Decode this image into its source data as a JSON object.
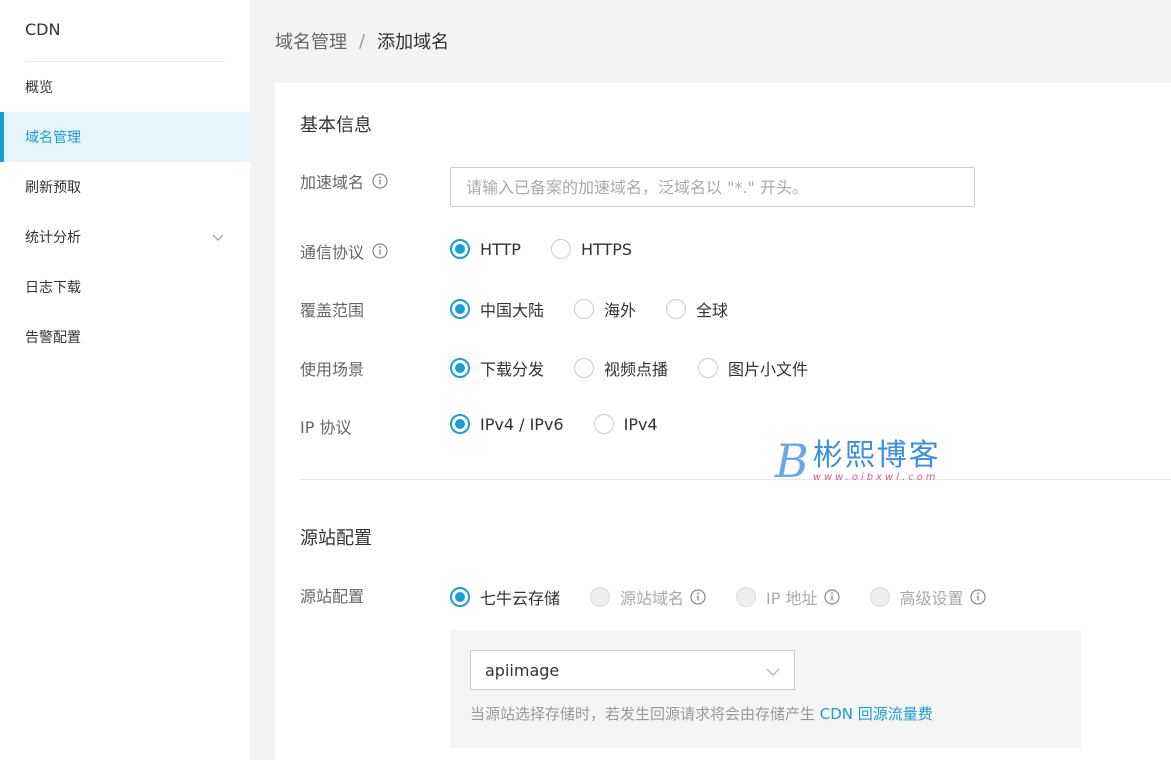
{
  "sidebar": {
    "brand": "CDN",
    "items": [
      {
        "label": "概览"
      },
      {
        "label": "域名管理"
      },
      {
        "label": "刷新预取"
      },
      {
        "label": "统计分析"
      },
      {
        "label": "日志下载"
      },
      {
        "label": "告警配置"
      }
    ]
  },
  "breadcrumb": {
    "parent": "域名管理",
    "separator": "/",
    "current": "添加域名"
  },
  "basic": {
    "title": "基本信息",
    "domain_label": "加速域名",
    "domain_placeholder": "请输入已备案的加速域名，泛域名以 \"*.\" 开头。",
    "protocol_label": "通信协议",
    "protocol_options": [
      "HTTP",
      "HTTPS"
    ],
    "coverage_label": "覆盖范围",
    "coverage_options": [
      "中国大陆",
      "海外",
      "全球"
    ],
    "scene_label": "使用场景",
    "scene_options": [
      "下载分发",
      "视频点播",
      "图片小文件"
    ],
    "ip_label": "IP 协议",
    "ip_options": [
      "IPv4 / IPv6",
      "IPv4"
    ]
  },
  "origin": {
    "title": "源站配置",
    "label": "源站配置",
    "options": [
      "七牛云存储",
      "源站域名",
      "IP 地址",
      "高级设置"
    ],
    "select_value": "apiimage",
    "hint_text": "当源站选择存储时，若发生回源请求将会由存储产生 ",
    "hint_link": "CDN 回源流量费"
  },
  "watermark": {
    "mark": "B",
    "name": "彬熙博客",
    "url": "www.oibxwl.com"
  },
  "colors": {
    "accent": "#1a9ed4",
    "active_bg": "#e6f5fb",
    "page_bg": "#f3f3f3"
  }
}
